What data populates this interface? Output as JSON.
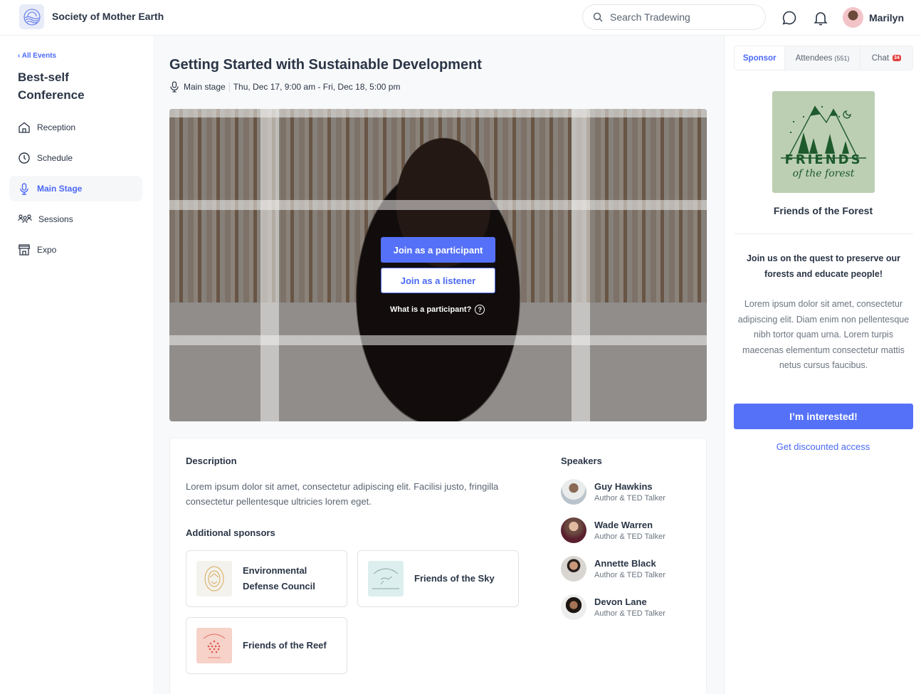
{
  "header": {
    "org_name": "Society of Mother Earth",
    "search_placeholder": "Search Tradewing",
    "user_name": "Marilyn",
    "icons": [
      "logo-icon",
      "search-icon",
      "chat-icon",
      "bell-icon"
    ]
  },
  "sidebar": {
    "back_label": "All Events",
    "event_title": "Best-self Conference",
    "items": [
      {
        "label": "Reception",
        "icon": "home-icon",
        "active": false
      },
      {
        "label": "Schedule",
        "icon": "clock-icon",
        "active": false
      },
      {
        "label": "Main Stage",
        "icon": "microphone-icon",
        "active": true
      },
      {
        "label": "Sessions",
        "icon": "people-icon",
        "active": false
      },
      {
        "label": "Expo",
        "icon": "store-icon",
        "active": false
      }
    ]
  },
  "main": {
    "title": "Getting Started with Sustainable Development",
    "location": "Main stage",
    "datetime": "Thu, Dec 17, 9:00 am - Fri, Dec 18, 5:00 pm",
    "video": {
      "join_participant": "Join as a participant",
      "join_listener": "Join as a listener",
      "help_text": "What is a participant?",
      "help_glyph": "?"
    },
    "description_heading": "Description",
    "description": "Lorem ipsum dolor sit amet, consectetur adipiscing elit. Facilisi justo, fringilla consectetur pellentesque ultricies lorem eget.",
    "sponsors_heading": "Additional sponsors",
    "sponsors": [
      {
        "name": "Environmental Defense Council",
        "logo_bg": "#f3f2ec"
      },
      {
        "name": "Friends of the Sky",
        "logo_bg": "#dcefee"
      },
      {
        "name": "Friends of the Reef",
        "logo_bg": "#f6d2c9"
      }
    ],
    "speakers_heading": "Speakers",
    "speakers": [
      {
        "name": "Guy Hawkins",
        "role": "Author & TED Talker"
      },
      {
        "name": "Wade Warren",
        "role": "Author & TED Talker"
      },
      {
        "name": "Annette Black",
        "role": "Author & TED Talker"
      },
      {
        "name": "Devon Lane",
        "role": "Author & TED Talker"
      }
    ]
  },
  "right_panel": {
    "tabs": [
      {
        "label": "Sponsor",
        "active": true
      },
      {
        "label": "Attendees",
        "count": "(551)"
      },
      {
        "label": "Chat",
        "badge": "34"
      }
    ],
    "sponsor_logo_line1": "FRIENDS",
    "sponsor_logo_line2": "of the forest",
    "sponsor_name": "Friends of the Forest",
    "tagline": "Join us on the quest to preserve our forests and educate people!",
    "body": "Lorem ipsum dolor sit amet, consectetur adipiscing elit. Diam enim non pellentesque nibh tortor quam urna. Lorem turpis maecenas elementum consectetur mattis netus cursus faucibus.",
    "cta_label": "I’m interested!",
    "link_label": "Get discounted access"
  },
  "colors": {
    "accent": "#5571f7",
    "text": "#2a3546",
    "muted": "#6b7480",
    "badge": "#e43d3d",
    "forest_green": "#1e5a2c"
  }
}
